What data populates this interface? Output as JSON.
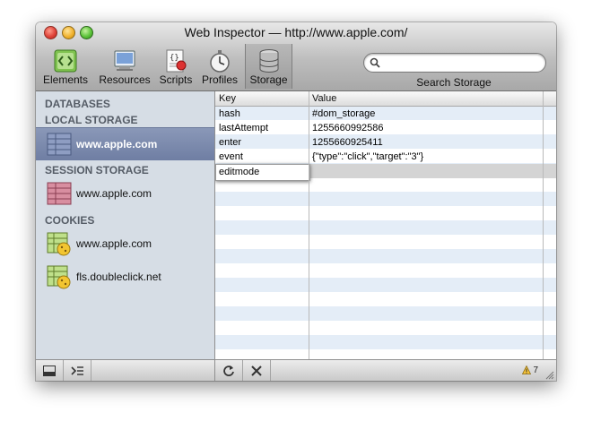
{
  "window": {
    "title": "Web Inspector — http://www.apple.com/"
  },
  "toolbar": {
    "items": [
      {
        "label": "Elements",
        "icon": "elements-icon"
      },
      {
        "label": "Resources",
        "icon": "resources-icon"
      },
      {
        "label": "Scripts",
        "icon": "scripts-icon"
      },
      {
        "label": "Profiles",
        "icon": "profiles-icon"
      },
      {
        "label": "Storage",
        "icon": "storage-icon",
        "selected": true
      }
    ],
    "search": {
      "value": "",
      "placeholder": "",
      "caption": "Search Storage"
    }
  },
  "sidebar": {
    "sections": {
      "databases": "DATABASES",
      "local": "LOCAL STORAGE",
      "session": "SESSION STORAGE",
      "cookies": "COOKIES"
    },
    "local_items": [
      {
        "label": "www.apple.com",
        "selected": true
      }
    ],
    "session_items": [
      {
        "label": "www.apple.com"
      }
    ],
    "cookie_items": [
      {
        "label": "www.apple.com"
      },
      {
        "label": "fls.doubleclick.net"
      }
    ]
  },
  "grid": {
    "headers": {
      "key": "Key",
      "value": "Value"
    },
    "rows": [
      {
        "key": "hash",
        "value": "#dom_storage"
      },
      {
        "key": "lastAttempt",
        "value": "1255660992586"
      },
      {
        "key": "enter",
        "value": "1255660925411"
      },
      {
        "key": "event",
        "value": "{\"type\":\"click\",\"target\":\"3\"}"
      }
    ],
    "editing_row": {
      "key": "editmode",
      "value": ""
    }
  },
  "statusbar": {
    "warning_count": "7",
    "buttons": [
      "dock-icon",
      "console-icon",
      "refresh-icon",
      "delete-icon"
    ]
  },
  "colors": {
    "selection": "#7282a8",
    "sidebar_bg": "#d6dde5",
    "row_stripe": "#e4edf7",
    "localstorage_icon": "#7e8fb8",
    "sessionstorage_icon": "#c4788a",
    "cookie_icon": "#f0c230"
  }
}
